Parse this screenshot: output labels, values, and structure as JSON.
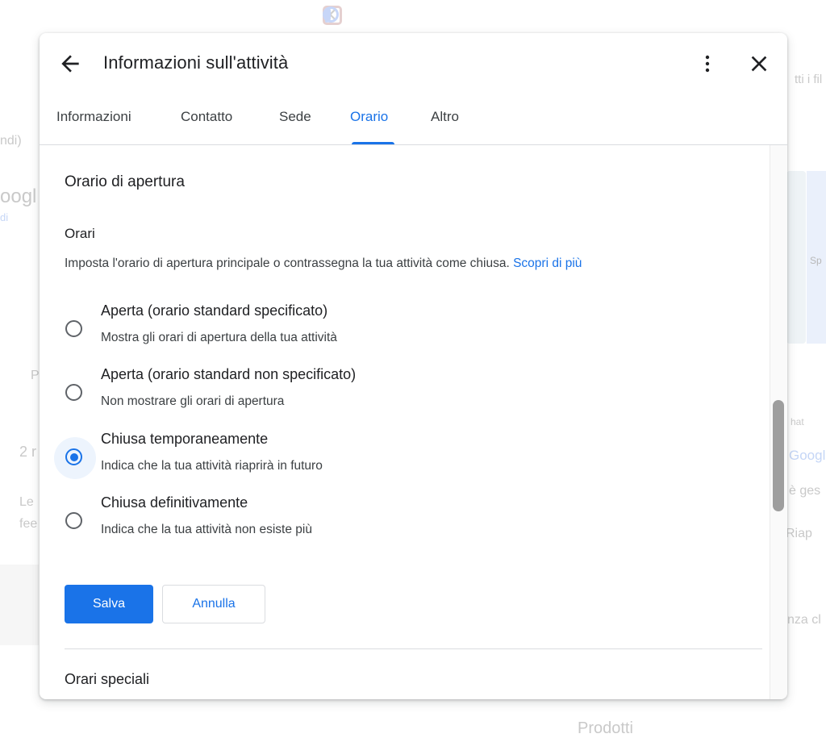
{
  "background": {
    "texts": [
      "tti i fil",
      "ndi)",
      "oogl",
      "di",
      "Sp",
      "P",
      "2 r",
      "hat",
      "Googl",
      "Le",
      "fee",
      "è ges",
      "Riap",
      "nza cl",
      "Prodotti"
    ]
  },
  "dialog": {
    "title": "Informazioni sull'attività",
    "tabs": [
      {
        "label": "Informazioni"
      },
      {
        "label": "Contatto"
      },
      {
        "label": "Sede"
      },
      {
        "label": "Orario",
        "active": true
      },
      {
        "label": "Altro"
      }
    ],
    "section_title": "Orario di apertura",
    "sub_title": "Orari",
    "description": "Imposta l'orario di apertura principale o contrassegna la tua attività come chiusa.",
    "learn_more": "Scopri di più",
    "options": [
      {
        "label": "Aperta (orario standard specificato)",
        "help": "Mostra gli orari di apertura della tua attività",
        "checked": false
      },
      {
        "label": "Aperta (orario standard non specificato)",
        "help": "Non mostrare gli orari di apertura",
        "checked": false
      },
      {
        "label": "Chiusa temporaneamente",
        "help": "Indica che la tua attività riaprirà in futuro",
        "checked": true
      },
      {
        "label": "Chiusa definitivamente",
        "help": "Indica che la tua attività non esiste più",
        "checked": false
      }
    ],
    "save_label": "Salva",
    "cancel_label": "Annulla",
    "special_hours": "Orari speciali"
  },
  "colors": {
    "accent": "#1a73e8",
    "text": "#202124",
    "secondary_text": "#3c4043"
  },
  "icons": {
    "back": "arrow-back-icon",
    "more": "more-vert-icon",
    "close": "close-icon"
  }
}
